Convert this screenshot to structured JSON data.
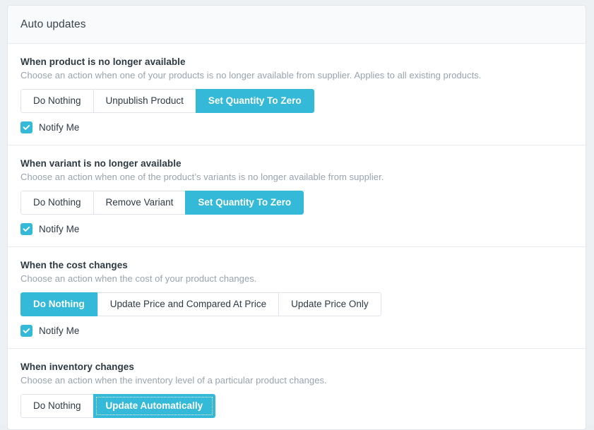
{
  "card": {
    "title": "Auto updates"
  },
  "sections": [
    {
      "title": "When product is no longer available",
      "description": "Choose an action when one of your products is no longer available from supplier. Applies to all existing products.",
      "options": [
        "Do Nothing",
        "Unpublish Product",
        "Set Quantity To Zero"
      ],
      "selected": "Set Quantity To Zero",
      "notify": {
        "label": "Notify Me",
        "checked": true
      }
    },
    {
      "title": "When variant is no longer available",
      "description": "Choose an action when one of the product’s variants is no longer available from supplier.",
      "options": [
        "Do Nothing",
        "Remove Variant",
        "Set Quantity To Zero"
      ],
      "selected": "Set Quantity To Zero",
      "notify": {
        "label": "Notify Me",
        "checked": true
      }
    },
    {
      "title": "When the cost changes",
      "description": "Choose an action when the cost of your product changes.",
      "options": [
        "Do Nothing",
        "Update Price and Compared At Price",
        "Update Price Only"
      ],
      "selected": "Do Nothing",
      "notify": {
        "label": "Notify Me",
        "checked": true
      }
    },
    {
      "title": "When inventory changes",
      "description": "Choose an action when the inventory level of a particular product changes.",
      "options": [
        "Do Nothing",
        "Update Automatically"
      ],
      "selected": "Update Automatically",
      "focused": "Update Automatically",
      "notify": null
    }
  ],
  "colors": {
    "accent": "#35b9d9",
    "heading": "#2e3a44",
    "description": "#9aa4ad",
    "border": "#e0e4e8",
    "page_bg": "#eef1f4",
    "header_bg": "#f8fafb"
  }
}
